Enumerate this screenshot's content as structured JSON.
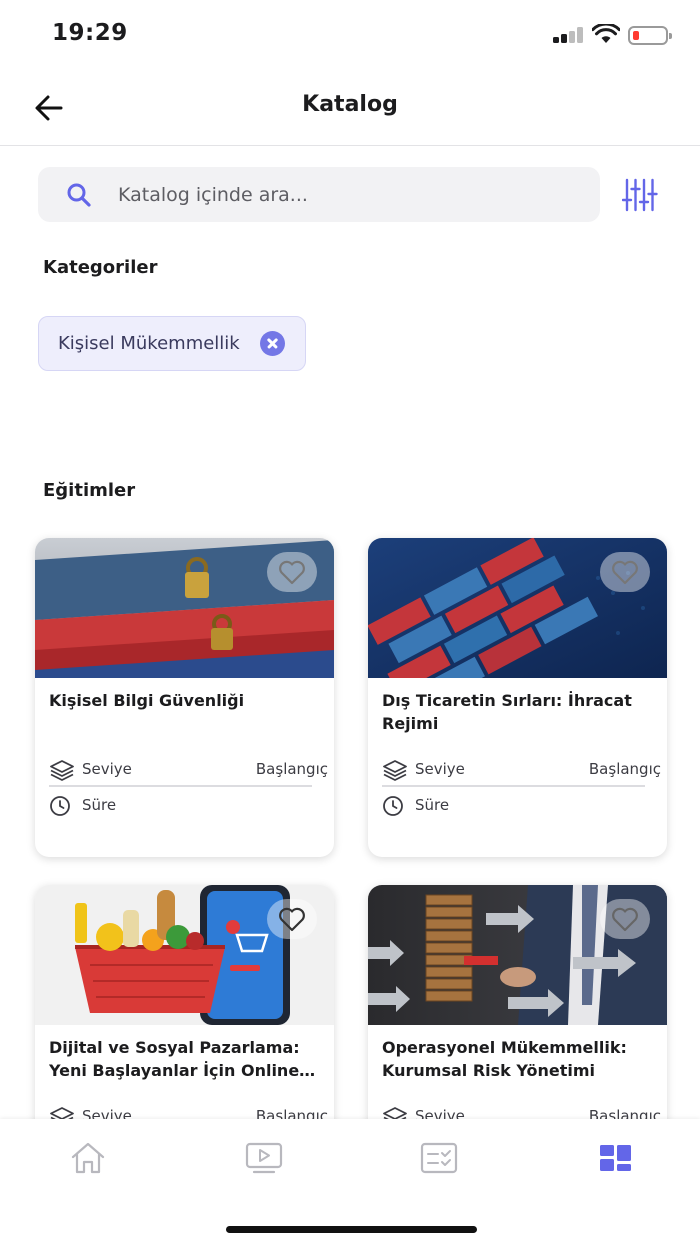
{
  "status_bar": {
    "time": "19:29"
  },
  "header": {
    "title": "Katalog"
  },
  "search": {
    "placeholder": "Katalog içinde ara..."
  },
  "categories": {
    "heading": "Kategoriler",
    "selected": [
      {
        "label": "Kişisel Mükemmellik"
      }
    ]
  },
  "trainings": {
    "heading": "Eğitimler",
    "items": [
      {
        "title": "Kişisel Bilgi Güvenliği",
        "level_label": "Seviye",
        "level_value": "Başlangıç",
        "duration_label": "Süre"
      },
      {
        "title": "Dış Ticaretin Sırları: İhracat Rejimi",
        "level_label": "Seviye",
        "level_value": "Başlangıç",
        "duration_label": "Süre"
      },
      {
        "title": "Dijital ve Sosyal Pazarlama: Yeni Başlayanlar İçin Online ...",
        "level_label": "Seviye",
        "level_value": "Başlangıç"
      },
      {
        "title": "Operasyonel Mükemmellik: Kurumsal Risk Yönetimi",
        "level_label": "Seviye",
        "level_value": "Başlangıç"
      }
    ]
  },
  "tab_bar": {
    "items": [
      {
        "icon": "home-icon"
      },
      {
        "icon": "video-player-icon"
      },
      {
        "icon": "checklist-icon"
      },
      {
        "icon": "catalog-grid-icon",
        "active": true
      }
    ]
  },
  "colors": {
    "accent": "#6366e8",
    "chip_bg": "#eeeefc",
    "search_bg": "#f2f2f4",
    "inactive_icon": "#b8b8be"
  }
}
